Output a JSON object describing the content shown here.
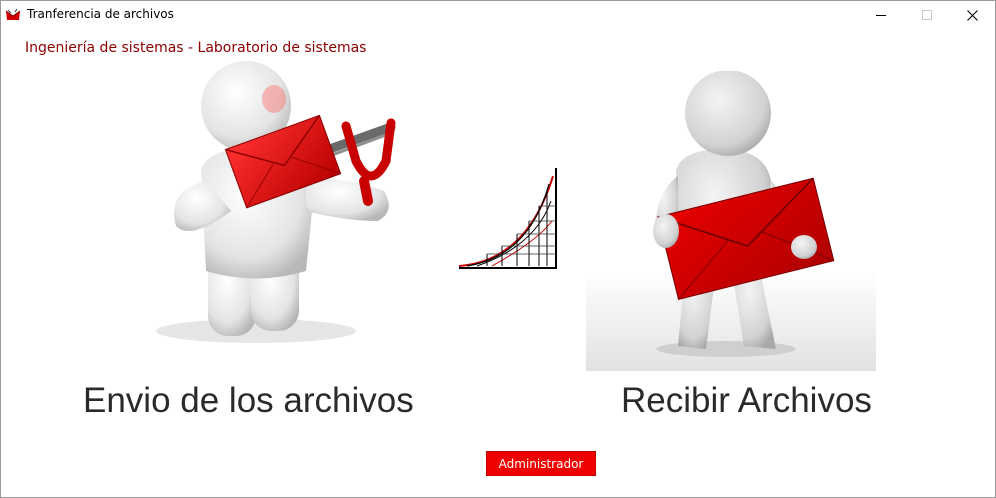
{
  "window": {
    "title": "Tranferencia de archivos",
    "controls": [
      "minimize",
      "maximize",
      "close"
    ]
  },
  "header": {
    "subtitle": "Ingeniería de sistemas - Laboratorio de sistemas"
  },
  "main": {
    "send_caption": "Envio de los archivos",
    "receive_caption": "Recibir Archivos",
    "admin_button_label": "Administrador"
  },
  "colors": {
    "accent": "#f00000",
    "subtitle": "#8b0000",
    "envelope": "#d90000"
  },
  "icons": [
    "app-logo-icon",
    "minimize-icon",
    "maximize-icon",
    "close-icon",
    "send-slingshot-illustration",
    "center-logo-icon",
    "receive-envelope-illustration"
  ]
}
